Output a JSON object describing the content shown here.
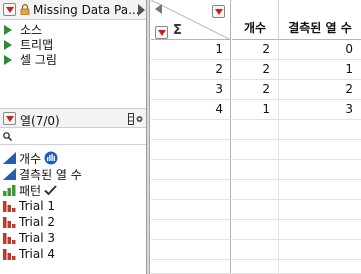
{
  "table_panel": {
    "title": "Missing Data Pa...",
    "scripts": [
      "소스",
      "트리맵",
      "셀 그림"
    ]
  },
  "columns_panel": {
    "title": "열(7/0)",
    "search": {
      "value": "",
      "placeholder": ""
    },
    "columns": [
      {
        "name": "개수",
        "icon": "continuous-icon",
        "badge": "frequency-icon"
      },
      {
        "name": "결측된 열 수",
        "icon": "continuous-icon",
        "badge": ""
      },
      {
        "name": "패턴",
        "icon": "ordinal-icon",
        "badge": "checkmark-icon"
      },
      {
        "name": "Trial 1",
        "icon": "nominal-icon",
        "badge": ""
      },
      {
        "name": "Trial 2",
        "icon": "nominal-icon",
        "badge": ""
      },
      {
        "name": "Trial 3",
        "icon": "nominal-icon",
        "badge": ""
      },
      {
        "name": "Trial 4",
        "icon": "nominal-icon",
        "badge": ""
      }
    ]
  },
  "grid": {
    "corner_symbol": "Σ",
    "headers": [
      "개수",
      "결측된 열 수"
    ],
    "rows": [
      {
        "num": "1",
        "cells": [
          "2",
          "0"
        ]
      },
      {
        "num": "2",
        "cells": [
          "2",
          "1"
        ]
      },
      {
        "num": "3",
        "cells": [
          "2",
          "2"
        ]
      },
      {
        "num": "4",
        "cells": [
          "1",
          "3"
        ]
      }
    ]
  },
  "colors": {
    "red_triangle": "#d21c1c",
    "script_play": "#2e8b2e",
    "continuous_icon": "#2b5ca8",
    "nominal_icon": "#c0392b",
    "ordinal_icon": "#3a9a3a",
    "grid_line": "#e2e2e2"
  }
}
